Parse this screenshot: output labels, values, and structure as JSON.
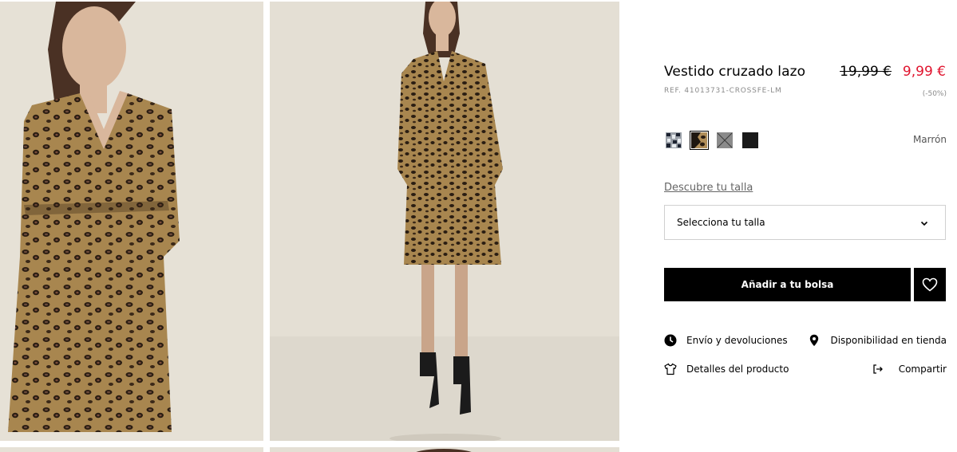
{
  "product": {
    "title": "Vestido cruzado lazo",
    "price_original": "19,99 €",
    "price_sale": "9,99 €",
    "reference": "REF. 41013731-CROSSFE-LM",
    "discount": "(-50%)"
  },
  "colors": {
    "selected_name": "Marrón",
    "swatches": [
      {
        "icon": "snake-print-swatch"
      },
      {
        "icon": "leopard-print-swatch",
        "selected": true
      },
      {
        "icon": "grey-swatch"
      },
      {
        "icon": "black-swatch"
      }
    ]
  },
  "size": {
    "guide_link": "Descubre tu talla",
    "select_label": "Selecciona tu talla"
  },
  "actions": {
    "add_to_bag": "Añadir a tu bolsa",
    "wishlist_icon": "heart-icon"
  },
  "links": {
    "shipping": "Envío y devoluciones",
    "stores": "Disponibilidad en tienda",
    "details": "Detalles del producto",
    "share": "Compartir"
  },
  "theme": {
    "sale_price_color": "#e0142e",
    "button_bg": "#000000",
    "button_text": "#ffffff"
  }
}
